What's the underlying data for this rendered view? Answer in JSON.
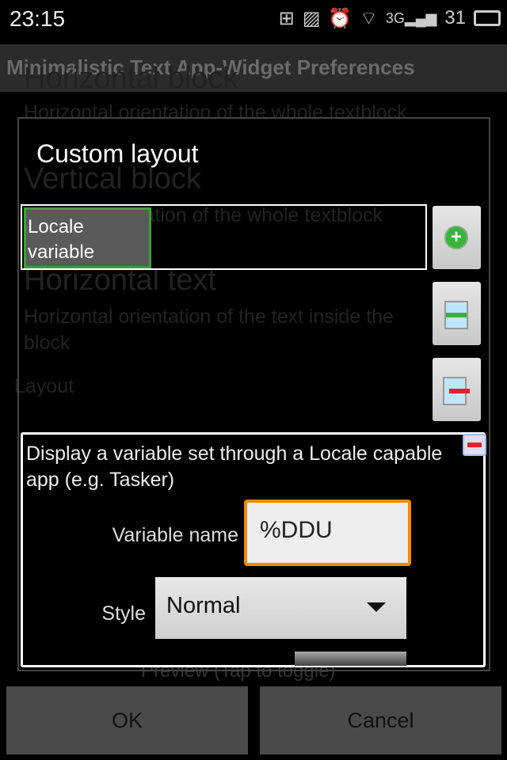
{
  "status_bar": {
    "time": "23:15",
    "battery": "31",
    "icons": [
      "grid-icon",
      "image-icon",
      "alarm-icon",
      "wifi-icon",
      "signal-3g-icon",
      "battery-icon"
    ]
  },
  "app_bar": {
    "title": "Minimalistic Text App-Widget Preferences"
  },
  "background": {
    "items": [
      {
        "title": "Horizontal block",
        "summary": "Horizontal orientation of the whole textblock"
      },
      {
        "title": "Vertical block",
        "summary": "Vertical orientation of the whole textblock"
      },
      {
        "title": "Horizontal text",
        "summary": "Horizontal orientation of the text inside the block"
      }
    ],
    "section": "Layout",
    "preview": "Preview (Tap to toggle)"
  },
  "dialog": {
    "title": "Custom layout",
    "list_items": [
      "Locale variable"
    ],
    "side_buttons": [
      "add-icon",
      "insert-icon",
      "remove-row-icon"
    ],
    "detail": {
      "description": "Display a variable set through a Locale capable app (e.g. Tasker)",
      "variable_label": "Variable name",
      "variable_value": "%DDU",
      "style_label": "Style",
      "style_value": "Normal"
    },
    "accent": "#f08a00"
  },
  "buttons": {
    "ok": "OK",
    "cancel": "Cancel"
  }
}
